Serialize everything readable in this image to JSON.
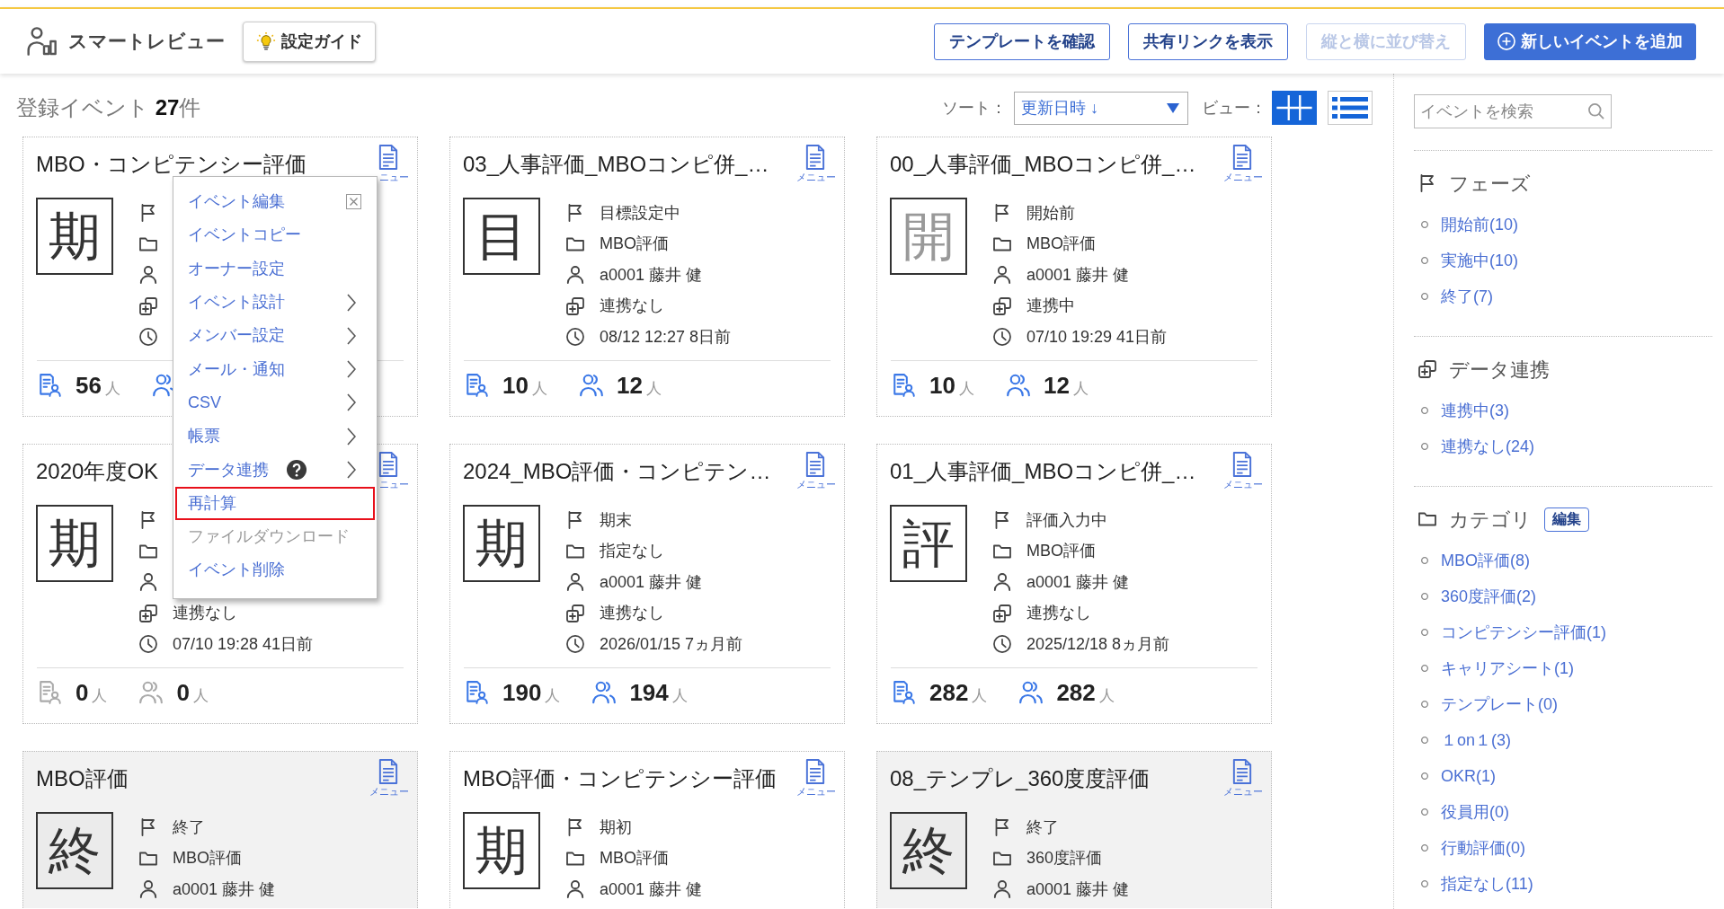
{
  "header": {
    "app_name": "スマートレビュー",
    "guide_button": "設定ガイド",
    "buttons": [
      {
        "label": "テンプレートを確認",
        "kind": "outline",
        "disabled": false
      },
      {
        "label": "共有リンクを表示",
        "kind": "outline",
        "disabled": false
      },
      {
        "label": "縦と横に並び替え",
        "kind": "outline",
        "disabled": true
      },
      {
        "label": "新しいイベントを追加",
        "kind": "primary",
        "disabled": false
      }
    ]
  },
  "toolbar": {
    "summary": "登録イベント **27**件",
    "sort_label": "ソート：",
    "sort_value": "更新日時 ↓",
    "view_label": "ビュー：",
    "views": [
      {
        "kind": "grid",
        "selected": true
      },
      {
        "kind": "list",
        "selected": false
      }
    ]
  },
  "cards": [
    {
      "title": "MBO・コンピテンシー評価",
      "menu_label": "ニュー",
      "kind": "active",
      "symbol": "期",
      "rows": [
        {
          "kind": "phase"
        },
        {
          "kind": "category"
        },
        {
          "kind": "owner"
        },
        {
          "kind": "link"
        },
        {
          "kind": "updated"
        }
      ],
      "stats_active": true,
      "stats": [
        {
          "kind": "respondents",
          "count": "56",
          "unit": "人"
        },
        {
          "kind": "members"
        }
      ]
    },
    {
      "title": "03_人事評価_MBOコンピ併_…",
      "menu_label": "メニュー",
      "kind": "active",
      "symbol": "目",
      "rows": [
        {
          "kind": "phase",
          "text": "目標設定中"
        },
        {
          "kind": "category",
          "text": "MBO評価"
        },
        {
          "kind": "owner",
          "text": "a0001 藤井 健"
        },
        {
          "kind": "link",
          "text": "連携なし"
        },
        {
          "kind": "updated",
          "text": "08/12 12:27 8日前"
        }
      ],
      "stats_active": true,
      "stats": [
        {
          "kind": "respondents",
          "count": "10",
          "unit": "人"
        },
        {
          "kind": "members",
          "count": "12",
          "unit": "人"
        }
      ]
    },
    {
      "title": "00_人事評価_MBOコンピ併_…",
      "menu_label": "メニュー",
      "kind": "before",
      "symbol": "開",
      "rows": [
        {
          "kind": "phase",
          "text": "開始前"
        },
        {
          "kind": "category",
          "text": "MBO評価"
        },
        {
          "kind": "owner",
          "text": "a0001 藤井 健"
        },
        {
          "kind": "link",
          "text": "連携中"
        },
        {
          "kind": "updated",
          "text": "07/10 19:29 41日前"
        }
      ],
      "stats_active": true,
      "stats": [
        {
          "kind": "respondents",
          "count": "10",
          "unit": "人"
        },
        {
          "kind": "members",
          "count": "12",
          "unit": "人"
        }
      ]
    },
    {
      "title": "2020年度OK",
      "menu_label": "ニュー",
      "kind": "active",
      "symbol": "期",
      "rows": [
        {
          "kind": "phase"
        },
        {
          "kind": "category"
        },
        {
          "kind": "owner"
        },
        {
          "kind": "link",
          "text": "連携なし"
        },
        {
          "kind": "updated",
          "text": "07/10 19:28 41日前"
        }
      ],
      "stats_active": false,
      "stats": [
        {
          "kind": "respondents",
          "count": "0",
          "unit": "人"
        },
        {
          "kind": "members",
          "count": "0",
          "unit": "人"
        }
      ]
    },
    {
      "title": "2024_MBO評価・コンピテン…",
      "menu_label": "メニュー",
      "kind": "active",
      "symbol": "期",
      "rows": [
        {
          "kind": "phase",
          "text": "期末"
        },
        {
          "kind": "category",
          "text": "指定なし"
        },
        {
          "kind": "owner",
          "text": "a0001 藤井 健"
        },
        {
          "kind": "link",
          "text": "連携なし"
        },
        {
          "kind": "updated",
          "text": "2026/01/15 7ヵ月前"
        }
      ],
      "stats_active": true,
      "stats": [
        {
          "kind": "respondents",
          "count": "190",
          "unit": "人"
        },
        {
          "kind": "members",
          "count": "194",
          "unit": "人"
        }
      ]
    },
    {
      "title": "01_人事評価_MBOコンピ併_…",
      "menu_label": "メニュー",
      "kind": "active",
      "symbol": "評",
      "rows": [
        {
          "kind": "phase",
          "text": "評価入力中"
        },
        {
          "kind": "category",
          "text": "MBO評価"
        },
        {
          "kind": "owner",
          "text": "a0001 藤井 健"
        },
        {
          "kind": "link",
          "text": "連携なし"
        },
        {
          "kind": "updated",
          "text": "2025/12/18 8ヵ月前"
        }
      ],
      "stats_active": true,
      "stats": [
        {
          "kind": "respondents",
          "count": "282",
          "unit": "人"
        },
        {
          "kind": "members",
          "count": "282",
          "unit": "人"
        }
      ]
    },
    {
      "title": "MBO評価",
      "menu_label": "メニュー",
      "kind": "ended",
      "symbol": "終",
      "rows": [
        {
          "kind": "phase",
          "text": "終了"
        },
        {
          "kind": "category",
          "text": "MBO評価"
        },
        {
          "kind": "owner",
          "text": "a0001 藤井 健"
        }
      ]
    },
    {
      "title": "MBO評価・コンピテンシー評価",
      "menu_label": "メニュー",
      "kind": "active",
      "symbol": "期",
      "rows": [
        {
          "kind": "phase",
          "text": "期初"
        },
        {
          "kind": "category",
          "text": "MBO評価"
        },
        {
          "kind": "owner",
          "text": "a0001 藤井 健"
        }
      ]
    },
    {
      "title": "08_テンプレ_360度度評価",
      "menu_label": "メニュー",
      "kind": "ended",
      "symbol": "終",
      "rows": [
        {
          "kind": "phase",
          "text": "終了"
        },
        {
          "kind": "category",
          "text": "360度評価"
        },
        {
          "kind": "owner",
          "text": "a0001 藤井 健"
        }
      ]
    }
  ],
  "context_menu": {
    "items": [
      {
        "label": "イベント編集",
        "submenu": false,
        "help": false,
        "highlighted": false,
        "disabled": false
      },
      {
        "label": "イベントコピー",
        "submenu": false,
        "help": false,
        "highlighted": false,
        "disabled": false
      },
      {
        "label": "オーナー設定",
        "submenu": false,
        "help": false,
        "highlighted": false,
        "disabled": false
      },
      {
        "label": "イベント設計",
        "submenu": true,
        "help": false,
        "highlighted": false,
        "disabled": false
      },
      {
        "label": "メンバー設定",
        "submenu": true,
        "help": false,
        "highlighted": false,
        "disabled": false
      },
      {
        "label": "メール・通知",
        "submenu": true,
        "help": false,
        "highlighted": false,
        "disabled": false
      },
      {
        "label": "CSV",
        "submenu": true,
        "help": false,
        "highlighted": false,
        "disabled": false
      },
      {
        "label": "帳票",
        "submenu": true,
        "help": false,
        "highlighted": false,
        "disabled": false
      },
      {
        "label": "データ連携",
        "submenu": true,
        "help": true,
        "highlighted": false,
        "disabled": false
      },
      {
        "label": "再計算",
        "submenu": false,
        "help": false,
        "highlighted": true,
        "disabled": false
      },
      {
        "label": "ファイルダウンロード",
        "submenu": false,
        "help": false,
        "highlighted": false,
        "disabled": true
      },
      {
        "label": "イベント削除",
        "submenu": false,
        "help": false,
        "highlighted": false,
        "disabled": false
      }
    ]
  },
  "sidebar": {
    "search": {
      "placeholder": "イベントを検索"
    },
    "sections": [
      {
        "kind": "phase",
        "title": "フェーズ",
        "items": [
          "開始前(10)",
          "実施中(10)",
          "終了(7)"
        ]
      },
      {
        "kind": "link",
        "title": "データ連携",
        "items": [
          "連携中(3)",
          "連携なし(24)"
        ]
      },
      {
        "kind": "category",
        "title": "カテゴリ",
        "edit_button": "編集",
        "items": [
          "MBO評価(8)",
          "360度評価(2)",
          "コンピテンシー評価(1)",
          "キャリアシート(1)",
          "テンプレート(0)",
          "１on１(3)",
          "OKR(1)",
          "役員用(0)",
          "行動評価(0)",
          "指定なし(11)"
        ]
      }
    ]
  }
}
